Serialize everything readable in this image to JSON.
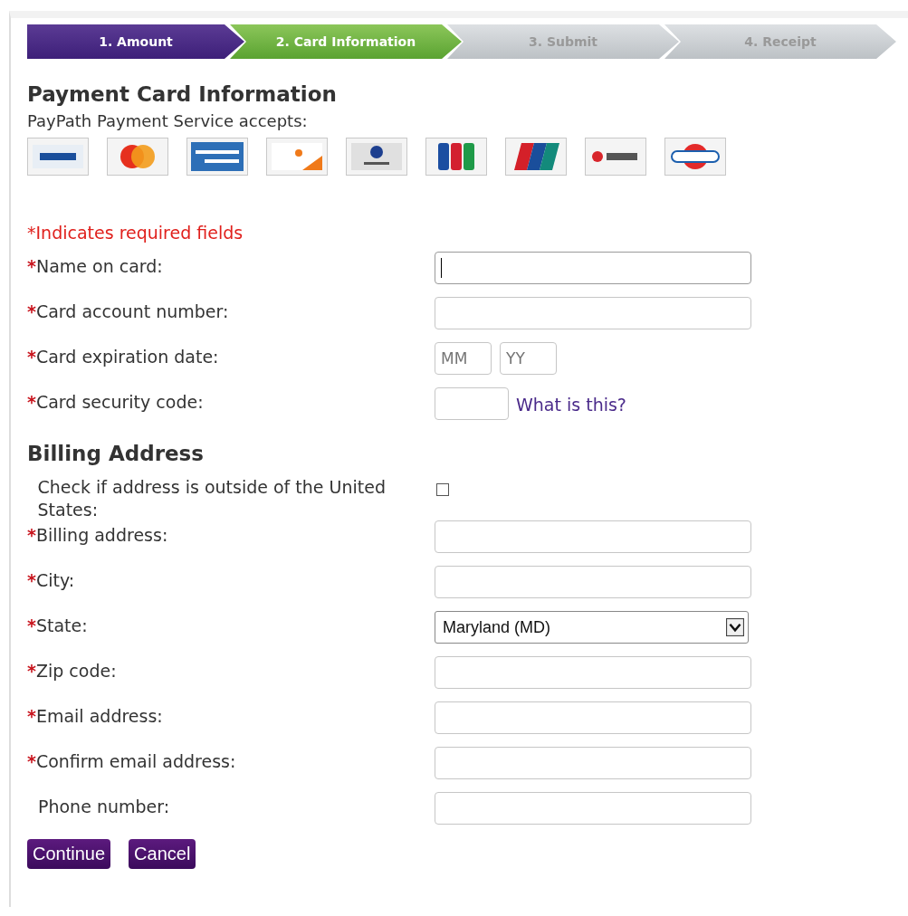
{
  "steps": [
    {
      "label": "1. Amount",
      "done": true,
      "selected": false
    },
    {
      "label": "2. Card Information",
      "done": false,
      "selected": true
    },
    {
      "label": "3. Submit",
      "done": false,
      "selected": false
    },
    {
      "label": "4. Receipt",
      "done": false,
      "selected": false
    }
  ],
  "title": "Payment Card Information",
  "accepts": "PayPath Payment Service accepts:",
  "cards": [
    {
      "kind": "visa"
    },
    {
      "kind": "mastercard"
    },
    {
      "kind": "amex"
    },
    {
      "kind": "discover"
    },
    {
      "kind": "diners"
    },
    {
      "kind": "jcb"
    },
    {
      "kind": "unionpay"
    },
    {
      "kind": "bccard"
    },
    {
      "kind": "dinacard"
    }
  ],
  "required_note": "*Indicates required fields",
  "card_fields": [
    {
      "kind": "text",
      "required_mark": "*",
      "label": "Name on card:",
      "focused": true
    },
    {
      "kind": "text",
      "required_mark": "*",
      "label": "Card account number:",
      "focused": false
    },
    {
      "kind": "date",
      "required_mark": "*",
      "label": "Card expiration date:",
      "month_placeholder": "MM",
      "year_placeholder": "YY"
    },
    {
      "kind": "code",
      "required_mark": "*",
      "label": "Card security code:",
      "link": "What is this?"
    }
  ],
  "billing_title": "Billing Address",
  "billing_fields": [
    {
      "kind": "checkbox",
      "label": "Check if address is outside of the United States:",
      "checked": false
    },
    {
      "kind": "text",
      "required_mark": "*",
      "label": "Billing address:",
      "focused": false
    },
    {
      "kind": "text",
      "required_mark": "*",
      "label": "City:",
      "focused": false
    },
    {
      "kind": "select",
      "required_mark": "*",
      "label": "State:",
      "value": "Maryland (MD)"
    },
    {
      "kind": "text",
      "required_mark": "*",
      "label": "Zip code:",
      "focused": false
    },
    {
      "kind": "text",
      "required_mark": "*",
      "label": "Email address:",
      "focused": false
    },
    {
      "kind": "text",
      "required_mark": "*",
      "label": "Confirm email address:",
      "focused": false
    },
    {
      "kind": "text",
      "label": "Phone number:",
      "focused": false
    }
  ],
  "buttons": [
    "Continue",
    "Cancel"
  ]
}
